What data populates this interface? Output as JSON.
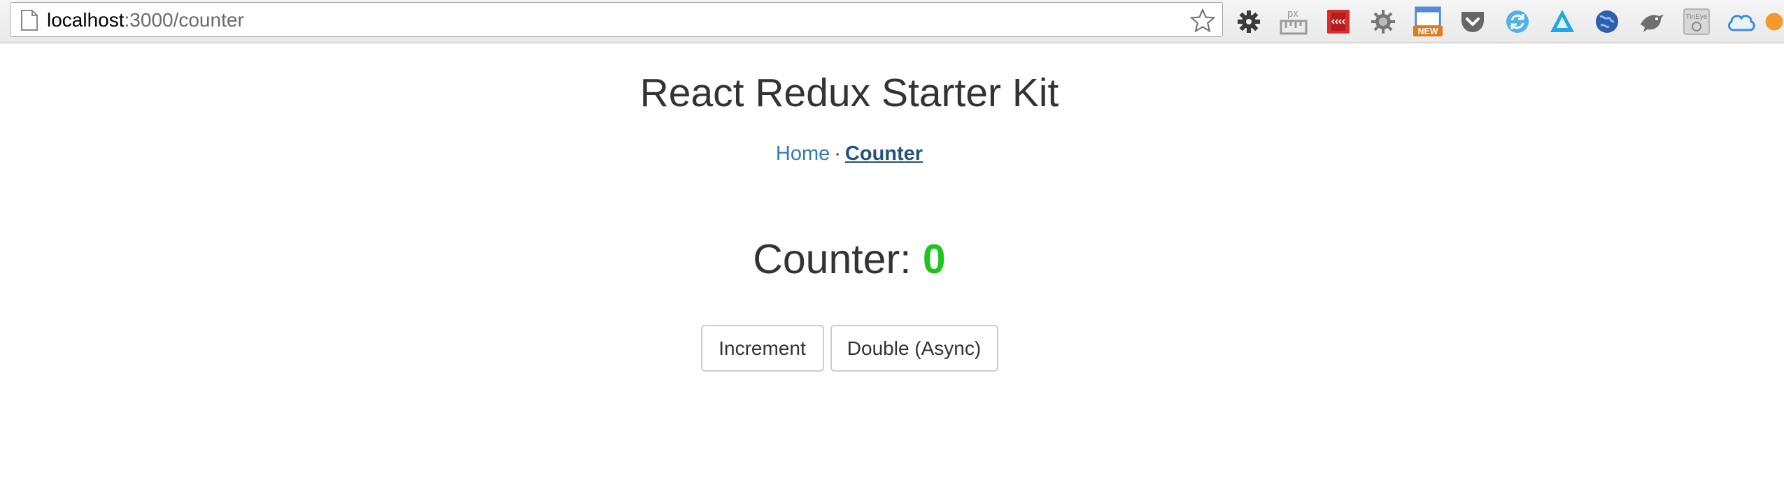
{
  "browser": {
    "url_host": "localhost",
    "url_path": ":3000/counter",
    "extensions": [
      {
        "name": "gear-icon",
        "color": "#3a3a3a"
      },
      {
        "name": "pixel-ruler-icon",
        "color": "#9a9a9a",
        "label": "px"
      },
      {
        "name": "red-book-icon",
        "color": "#d32f2f"
      },
      {
        "name": "bug-gear-icon",
        "color": "#777777"
      },
      {
        "name": "new-window-icon",
        "color": "#4f8bd6",
        "badge": "NEW"
      },
      {
        "name": "pocket-icon",
        "color": "#666666"
      },
      {
        "name": "sync-icon",
        "color": "#4fb3e8"
      },
      {
        "name": "triangle-logo-icon",
        "color": "#22a7e6"
      },
      {
        "name": "globe-icon",
        "color": "#2f5fa8"
      },
      {
        "name": "bird-icon",
        "color": "#6f6f6f"
      },
      {
        "name": "tineye-icon",
        "color": "#b5b5b5",
        "label": "TinEye"
      },
      {
        "name": "cloud-icon",
        "color": "#3c8ed6"
      },
      {
        "name": "orange-circle-icon",
        "color": "#f39a2b"
      }
    ]
  },
  "page": {
    "title": "React Redux Starter Kit",
    "nav": {
      "home_label": "Home",
      "separator": "·",
      "counter_label": "Counter"
    },
    "counter": {
      "label": "Counter: ",
      "value": "0",
      "value_color": "#1ec51e"
    },
    "buttons": {
      "increment_label": "Increment",
      "double_label": "Double (Async)"
    }
  },
  "colors": {
    "link": "#337ab7",
    "link_active": "#23527c",
    "text": "#333333"
  }
}
